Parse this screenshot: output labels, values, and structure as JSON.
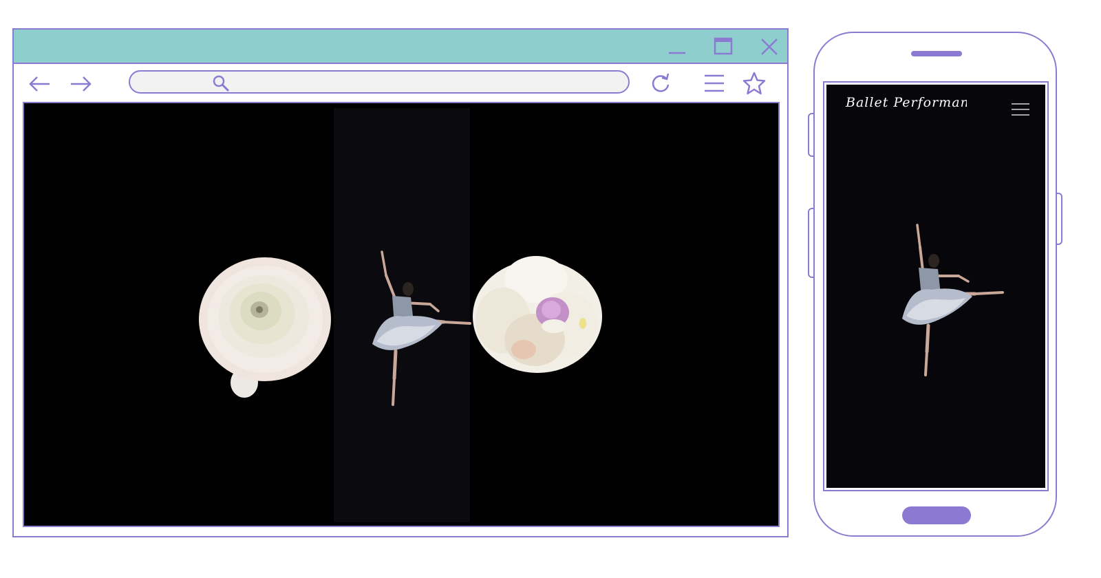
{
  "browser": {
    "address": {
      "value": "",
      "placeholder": ""
    }
  },
  "mobile": {
    "logo_text": "Ballet Performance"
  },
  "colors": {
    "frame": "#8c7ad2",
    "titlebar": "#8ecfce",
    "address_bg": "#f2f2f2",
    "page_bg": "#000000",
    "strip_bg": "#0b0a0f",
    "mobile_bg": "#07060a"
  },
  "icons": {
    "back": "arrow-left-icon",
    "forward": "arrow-right-icon",
    "search": "search-icon",
    "reload": "reload-icon",
    "menu": "hamburger-menu-icon",
    "bookmark": "star-icon",
    "minimize": "minimize-icon",
    "maximize": "maximize-icon",
    "close": "close-icon"
  }
}
